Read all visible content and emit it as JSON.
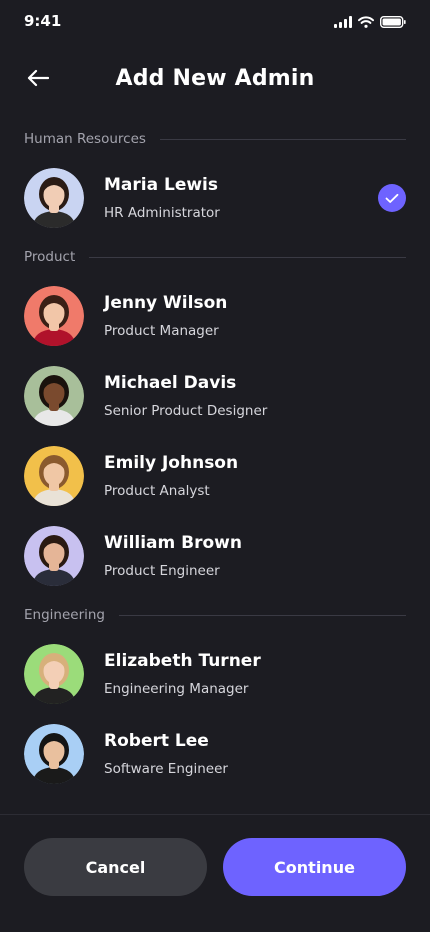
{
  "status": {
    "time": "9:41"
  },
  "header": {
    "title": "Add New Admin"
  },
  "sections": [
    {
      "label": "Human Resources",
      "people": [
        {
          "name": "Maria Lewis",
          "role": "HR Administrator",
          "selected": true,
          "avatar_bg": "#c9d4f2",
          "skin": "#f1cdb5",
          "hair": "#2a1b15",
          "shirt": "#2b2b2b"
        }
      ]
    },
    {
      "label": "Product",
      "people": [
        {
          "name": "Jenny Wilson",
          "role": "Product Manager",
          "selected": false,
          "avatar_bg": "#f07a6a",
          "skin": "#f2c6a8",
          "hair": "#3a2016",
          "shirt": "#b0122b"
        },
        {
          "name": "Michael Davis",
          "role": "Senior Product Designer",
          "selected": false,
          "avatar_bg": "#a8bf9a",
          "skin": "#7a4a2e",
          "hair": "#1a120d",
          "shirt": "#e8e8e8"
        },
        {
          "name": "Emily Johnson",
          "role": "Product Analyst",
          "selected": false,
          "avatar_bg": "#f2c04a",
          "skin": "#f0c7a5",
          "hair": "#8a5a2e",
          "shirt": "#e9e2d7"
        },
        {
          "name": "William Brown",
          "role": "Product Engineer",
          "selected": false,
          "avatar_bg": "#c8c1f0",
          "skin": "#e5b597",
          "hair": "#2a1a12",
          "shirt": "#2a2d3a"
        }
      ]
    },
    {
      "label": "Engineering",
      "people": [
        {
          "name": "Elizabeth Turner",
          "role": "Engineering Manager",
          "selected": false,
          "avatar_bg": "#9bdc7a",
          "skin": "#f3cfb6",
          "hair": "#d7b07b",
          "shirt": "#222222"
        },
        {
          "name": "Robert Lee",
          "role": "Software Engineer",
          "selected": false,
          "avatar_bg": "#a9cff5",
          "skin": "#e9c09e",
          "hair": "#151515",
          "shirt": "#1a1a1a"
        }
      ]
    }
  ],
  "actions": {
    "cancel_label": "Cancel",
    "continue_label": "Continue"
  },
  "colors": {
    "accent": "#6e63ff",
    "background": "#1c1c22",
    "cancel_bg": "#3a3b41"
  },
  "icons": {
    "back": "arrow-left-icon",
    "check": "check-icon",
    "signal": "signal-icon",
    "wifi": "wifi-icon",
    "battery": "battery-icon"
  }
}
